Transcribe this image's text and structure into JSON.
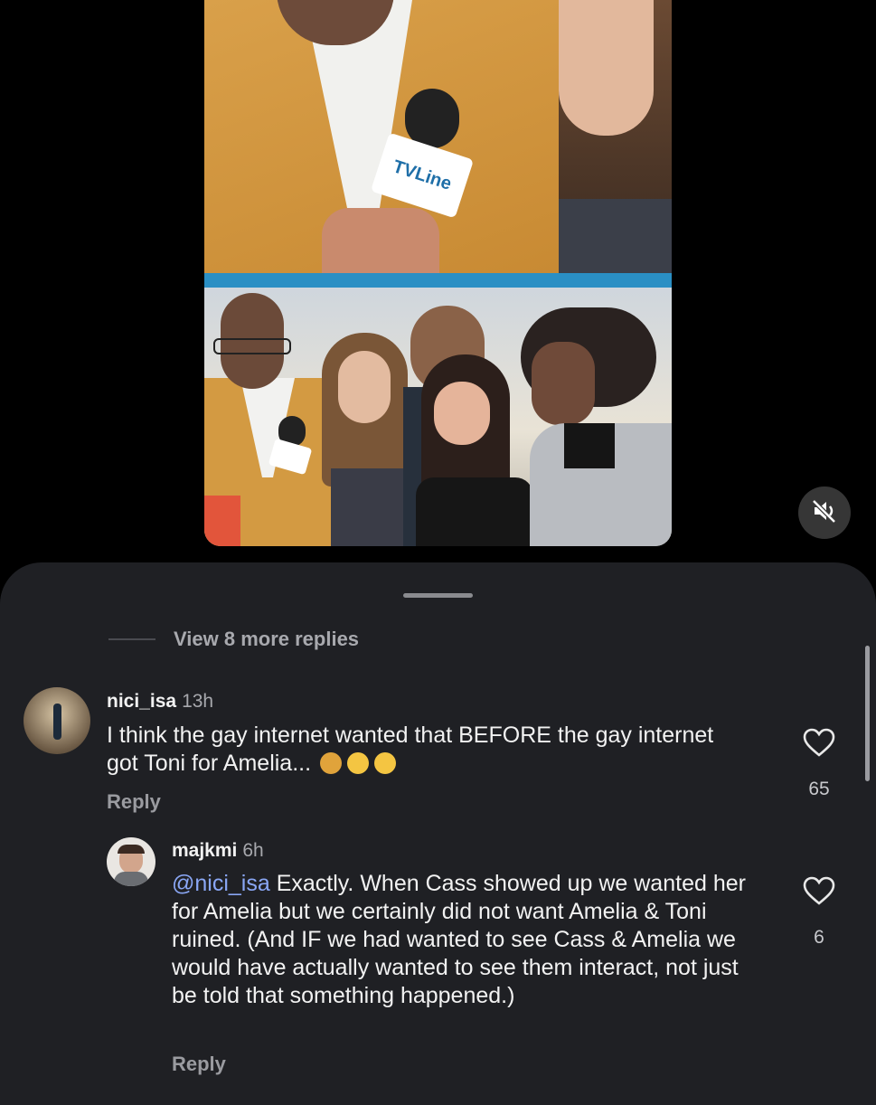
{
  "video": {
    "mic_brand": "TVLine",
    "mute_icon": "speaker-muted-icon"
  },
  "comments": {
    "view_more": "View 8 more replies",
    "items": [
      {
        "user": "nici_isa",
        "time": "13h",
        "text": "I think the gay internet wanted that BEFORE the gay internet got Toni for Amelia...",
        "emojis": [
          "see-no-evil-monkey",
          "face-with-open-eyes-and-hand-over-mouth",
          "pleading-face"
        ],
        "reply_label": "Reply",
        "likes": "65"
      },
      {
        "user": "majkmi",
        "time": "6h",
        "mention": "@nici_isa",
        "text": " Exactly. When Cass showed up we wanted her for Amelia but we certainly did not want Amelia & Toni ruined. (And IF we had wanted to see Cass & Amelia we would have actually wanted to see them interact, not just be told that something happened.)",
        "reply_label": "Reply",
        "likes": "6"
      }
    ]
  },
  "colors": {
    "sheet_bg": "#1f2024",
    "mention": "#8aa7f5",
    "accent_strip": "#2a8fc4"
  }
}
